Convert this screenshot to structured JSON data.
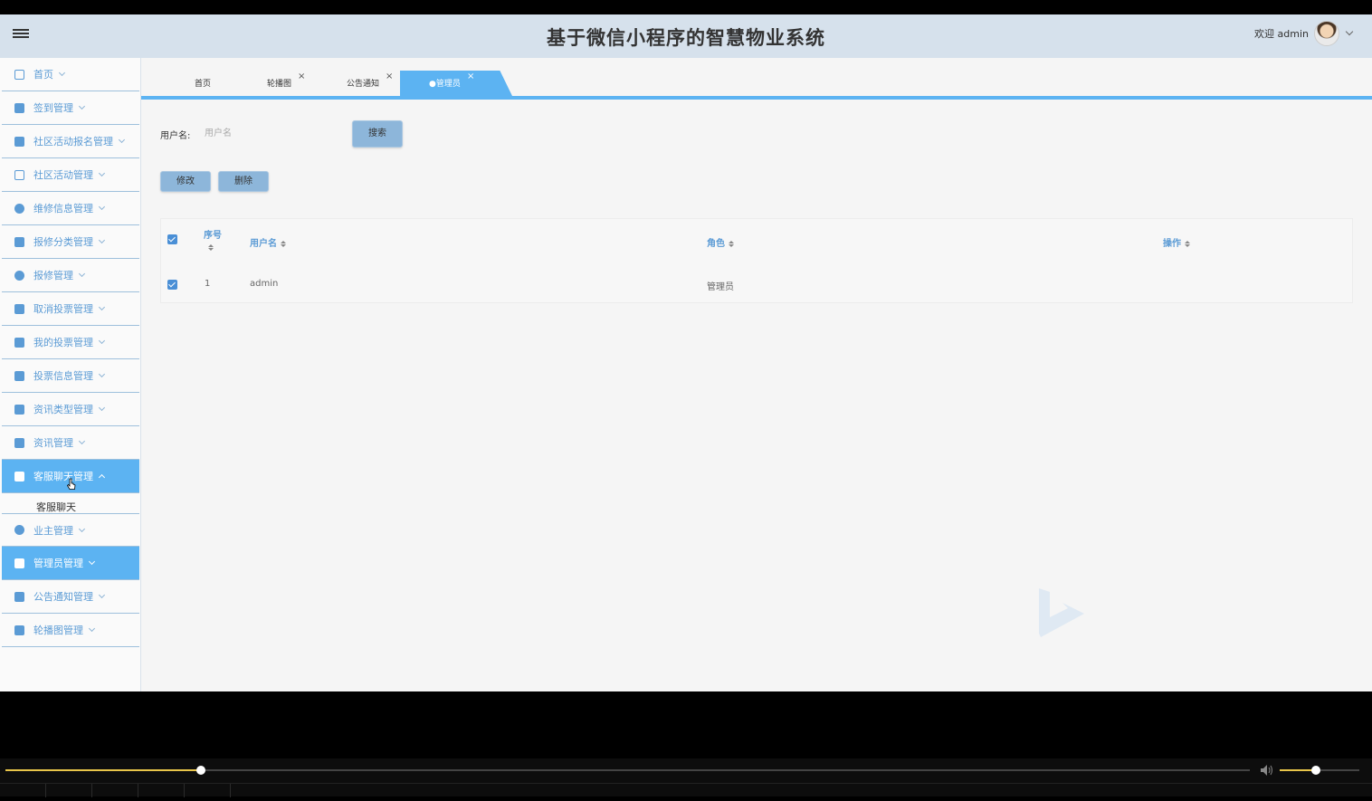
{
  "header": {
    "title": "基于微信小程序的智慧物业系统",
    "welcome": "欢迎 admin"
  },
  "sidebar": {
    "items": [
      {
        "label": "首页",
        "icon": "home-icon"
      },
      {
        "label": "签到管理",
        "icon": "checkin-icon"
      },
      {
        "label": "社区活动报名管理",
        "icon": "grid-icon"
      },
      {
        "label": "社区活动管理",
        "icon": "panel-icon"
      },
      {
        "label": "维修信息管理",
        "icon": "settings-icon"
      },
      {
        "label": "报修分类管理",
        "icon": "category-icon"
      },
      {
        "label": "报修管理",
        "icon": "gauge-icon"
      },
      {
        "label": "取消投票管理",
        "icon": "building-icon"
      },
      {
        "label": "我的投票管理",
        "icon": "vote-icon"
      },
      {
        "label": "投票信息管理",
        "icon": "mail-icon"
      },
      {
        "label": "资讯类型管理",
        "icon": "ticket-icon"
      },
      {
        "label": "资讯管理",
        "icon": "news-icon"
      },
      {
        "label": "客服聊天管理",
        "icon": "chat-icon"
      },
      {
        "label": "业主管理",
        "icon": "owner-icon"
      },
      {
        "label": "管理员管理",
        "icon": "admin-icon"
      },
      {
        "label": "公告通知管理",
        "icon": "notice-icon"
      },
      {
        "label": "轮播图管理",
        "icon": "carousel-icon"
      }
    ],
    "submenu_chat": "客服聊天"
  },
  "tabs": [
    {
      "label": "首页"
    },
    {
      "label": "轮播图",
      "close": "×"
    },
    {
      "label": "公告通知",
      "close": "×"
    },
    {
      "label": "●管理员",
      "close": "×"
    }
  ],
  "search": {
    "label": "用户名:",
    "placeholder": "用户名",
    "button": "搜索"
  },
  "actions": {
    "edit": "修改",
    "delete": "删除"
  },
  "table": {
    "headers": {
      "index": "序号",
      "username": "用户名",
      "role": "角色",
      "ops": "操作"
    },
    "rows": [
      {
        "index": "1",
        "username": "admin",
        "role": "管理员"
      }
    ]
  },
  "player": {
    "progress": 0.157,
    "volume": 0.45
  },
  "colors": {
    "header_bg": "#d6e1ec",
    "accent": "#5cb3f2",
    "nav_text": "#5b9bd5",
    "button_bg": "#8db6da",
    "player_accent": "#e8c54a"
  }
}
